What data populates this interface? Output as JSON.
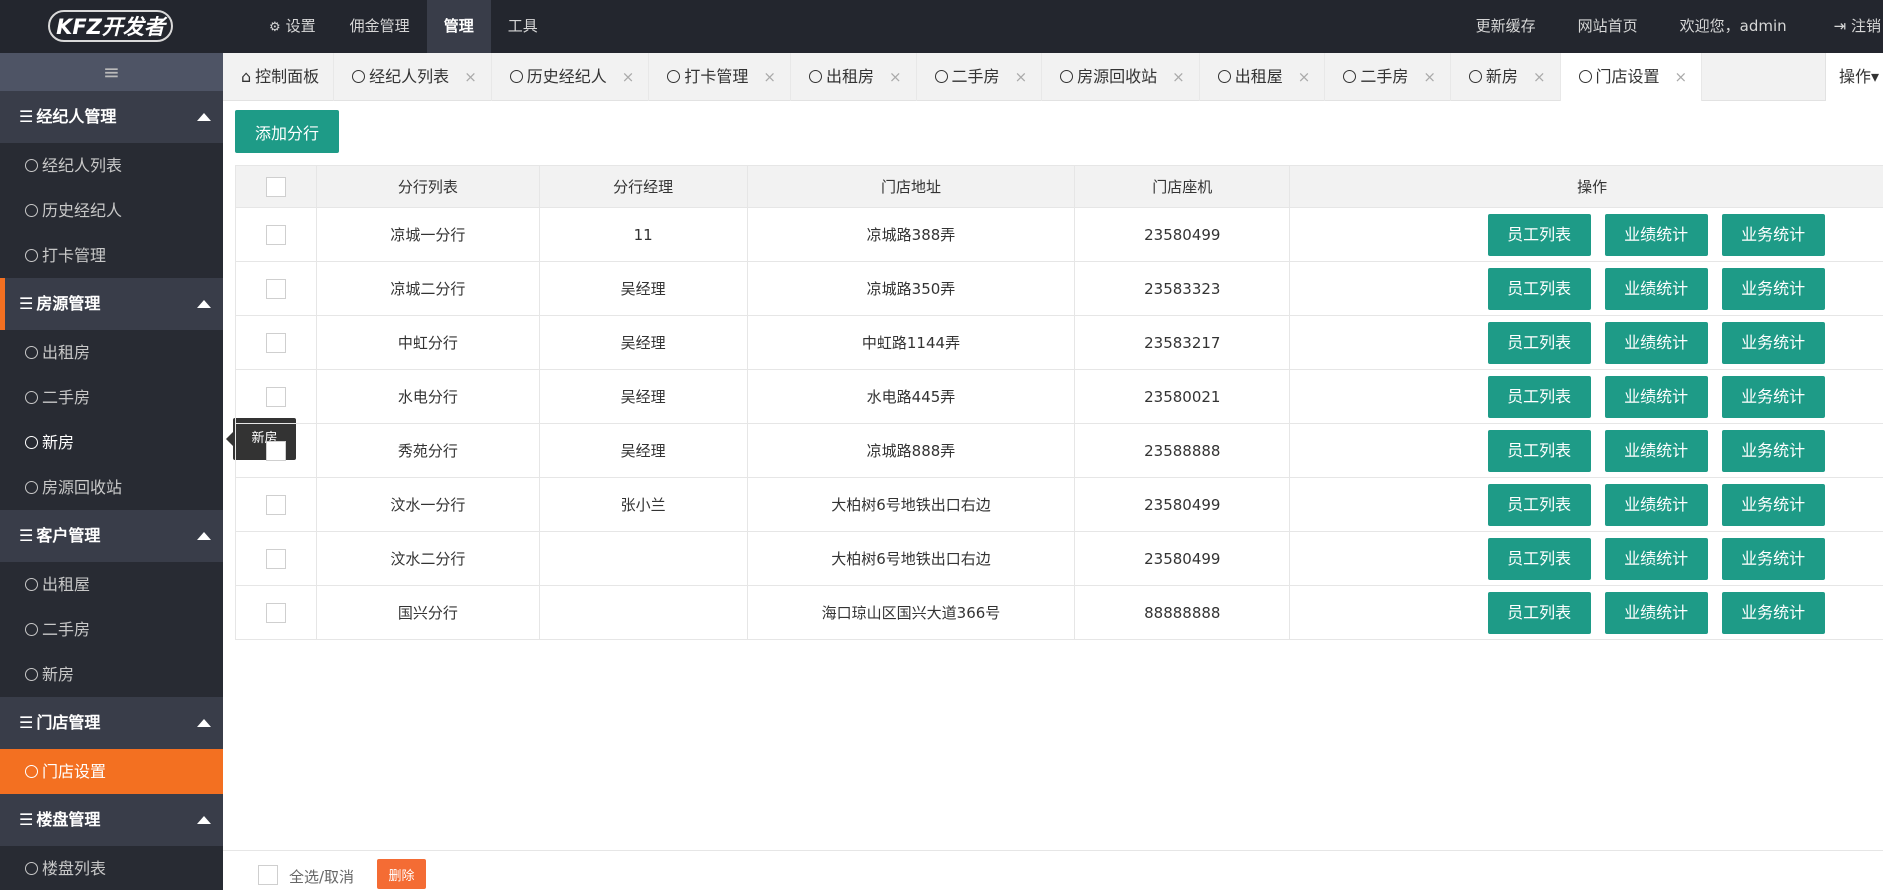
{
  "app": {
    "logo_text": "KFZ开发者"
  },
  "topnav": {
    "items": [
      {
        "label": "设置",
        "icon": "gears-icon"
      },
      {
        "label": "佣金管理"
      },
      {
        "label": "管理",
        "active": true
      },
      {
        "label": "工具"
      }
    ],
    "right": [
      "更新缓存",
      "网站首页",
      "欢迎您，admin",
      "注销"
    ],
    "logout_icon": "logout-icon"
  },
  "sidebar": {
    "toggle_icon": "≡",
    "sections": [
      {
        "title": "经纪人管理",
        "items": [
          "经纪人列表",
          "历史经纪人",
          "打卡管理"
        ]
      },
      {
        "title": "房源管理",
        "items": [
          "出租房",
          "二手房",
          "新房",
          "房源回收站"
        ]
      },
      {
        "title": "客户管理",
        "items": [
          "出租屋",
          "二手房",
          "新房"
        ]
      },
      {
        "title": "门店管理",
        "items": [
          "门店设置"
        ]
      },
      {
        "title": "楼盘管理",
        "items": [
          "楼盘列表"
        ]
      }
    ],
    "hover_tooltip": "新房",
    "selected_item": "门店设置"
  },
  "tabs": [
    {
      "label": "控制面板",
      "home": true
    },
    {
      "label": "经纪人列表"
    },
    {
      "label": "历史经纪人"
    },
    {
      "label": "打卡管理"
    },
    {
      "label": "出租房"
    },
    {
      "label": "二手房"
    },
    {
      "label": "房源回收站"
    },
    {
      "label": "出租屋"
    },
    {
      "label": "二手房"
    },
    {
      "label": "新房"
    },
    {
      "label": "门店设置",
      "active": true
    }
  ],
  "tab_close": "×",
  "tab_ops_label": "操作",
  "main": {
    "add_button": "添加分行",
    "columns": [
      "分行列表",
      "分行经理",
      "门店地址",
      "门店座机",
      "操作"
    ],
    "rows": [
      {
        "name": "凉城一分行",
        "manager": "11",
        "address": "凉城路388弄",
        "phone": "23580499"
      },
      {
        "name": "凉城二分行",
        "manager": "吴经理",
        "address": "凉城路350弄",
        "phone": "23583323"
      },
      {
        "name": "中虹分行",
        "manager": "吴经理",
        "address": "中虹路1144弄",
        "phone": "23583217"
      },
      {
        "name": "水电分行",
        "manager": "吴经理",
        "address": "水电路445弄",
        "phone": "23580021"
      },
      {
        "name": "秀苑分行",
        "manager": "吴经理",
        "address": "凉城路888弄",
        "phone": "23588888"
      },
      {
        "name": "汶水一分行",
        "manager": "张小兰",
        "address": "大柏树6号地铁出口右边",
        "phone": "23580499"
      },
      {
        "name": "汶水二分行",
        "manager": "",
        "address": "大柏树6号地铁出口右边",
        "phone": "23580499"
      },
      {
        "name": "国兴分行",
        "manager": "",
        "address": "海口琼山区国兴大道366号",
        "phone": "88888888"
      }
    ],
    "row_actions": [
      "员工列表",
      "业绩统计",
      "业务统计"
    ]
  },
  "footer": {
    "select_all": "全选/取消",
    "delete_button": "删除"
  },
  "colors": {
    "topbar": "#23262e",
    "sidebar": "#393d49",
    "accent": "#f37021",
    "primary_button": "#1e9b87"
  }
}
